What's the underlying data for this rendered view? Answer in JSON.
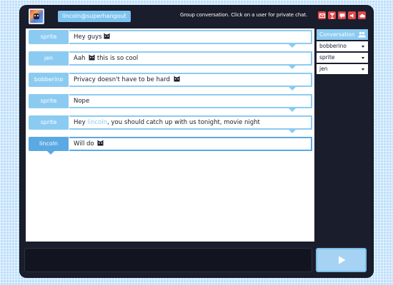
{
  "header": {
    "username": "lincoln@superhangout",
    "status_text": "Group conversation. Click on a user for private chat.",
    "icons": [
      "mail-icon",
      "cocktail-icon",
      "chat-icon",
      "speaker-icon",
      "cloud-icon"
    ]
  },
  "messages": [
    {
      "sender": "sprite",
      "text": "Hey guys",
      "emoji": "cat-face-icon"
    },
    {
      "sender": "jen",
      "text_before": "Aah",
      "emoji": "cat-face-icon",
      "text_after": "this is so cool"
    },
    {
      "sender": "bobberino",
      "text": "Privacy doesn't have to be hard",
      "emoji": "cat-face-icon"
    },
    {
      "sender": "sprite",
      "text": "Nope"
    },
    {
      "sender": "sprite",
      "text_before": "Hey",
      "mention": "lincoln",
      "text_after": ", you should catch up with us tonight, movie night"
    },
    {
      "sender": "lincoln",
      "text": "Will do",
      "emoji": "cat-face-icon"
    }
  ],
  "sidebar": {
    "header": "Conversation",
    "header_icon": "people-icon",
    "users": [
      "bobberino",
      "sprite",
      "jen"
    ]
  },
  "composer": {
    "value": "",
    "send_icon": "play-icon"
  },
  "colors": {
    "frame": "#1a1d2c",
    "accent": "#8ccbf1",
    "self_accent": "#5aa9e3",
    "icon_red": "#e0484b",
    "send_button": "#a6d3f3"
  }
}
